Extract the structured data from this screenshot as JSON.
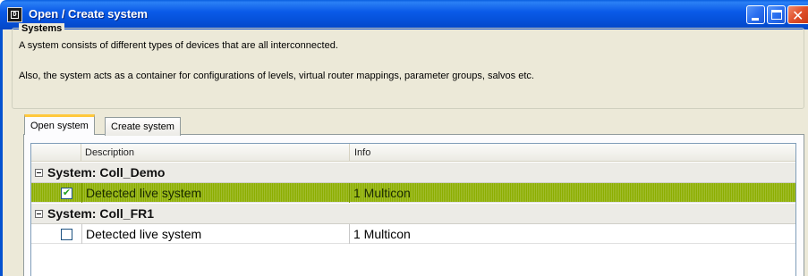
{
  "window": {
    "title": "Open / Create system",
    "icon_glyph": "D",
    "controls": [
      "minimize-icon",
      "maximize-icon",
      "close-icon"
    ]
  },
  "systems_group": {
    "legend": "Systems",
    "line1": "A system consists of different types of devices that are all interconnected.",
    "line2": "Also, the system acts as a container for configurations of levels, virtual router mappings, parameter groups, salvos etc."
  },
  "tabs": [
    {
      "label": "Open system",
      "active": true
    },
    {
      "label": "Create system",
      "active": false
    }
  ],
  "grid": {
    "columns": {
      "description": "Description",
      "info": "Info"
    },
    "groups": [
      {
        "label": "System: Coll_Demo",
        "rows": [
          {
            "description": "Detected live system",
            "info": "1 Multicon",
            "checked": true,
            "check_glyph": "✔",
            "selected": true
          }
        ]
      },
      {
        "label": "System: Coll_FR1",
        "rows": [
          {
            "description": "Detected live system",
            "info": "1 Multicon",
            "checked": false,
            "check_glyph": "",
            "selected": false
          }
        ]
      }
    ]
  },
  "colors": {
    "titlebar": "#0551d9",
    "selected_row": "#8cae00",
    "active_tab_accent": "#ffc83c"
  }
}
